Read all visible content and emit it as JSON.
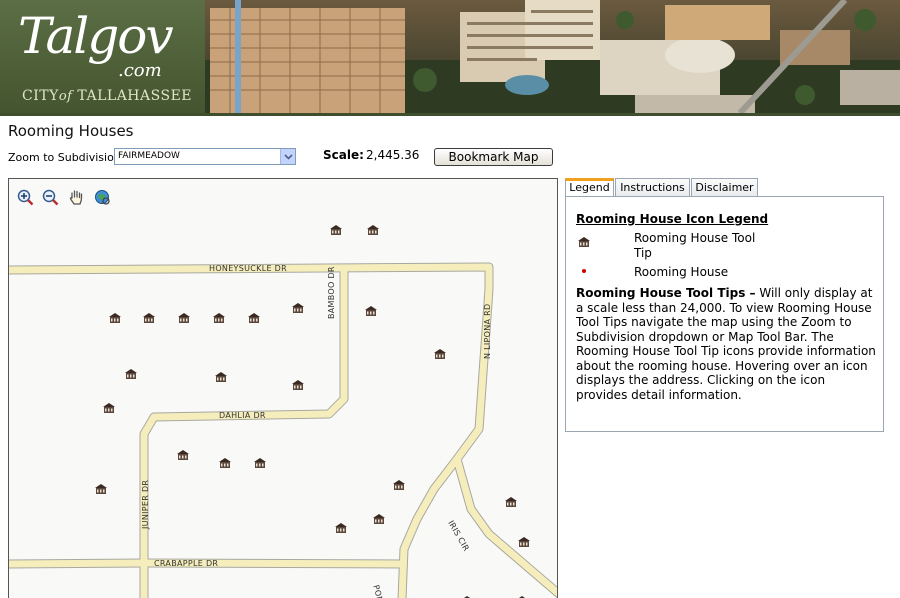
{
  "banner": {
    "logo_main": "Talgov",
    "logo_sub": ".com",
    "logo_city_a": "CITY",
    "logo_city_of": "of",
    "logo_city_b": "TALLAHASSEE"
  },
  "page": {
    "title": "Rooming Houses"
  },
  "controls": {
    "zoom_label": "Zoom to Subdivision",
    "subdivision_selected": "FAIRMEADOW",
    "scale_label": "Scale:",
    "scale_value": "2,445.36",
    "bookmark_label": "Bookmark Map"
  },
  "map": {
    "tools": [
      "zoom-in-icon",
      "zoom-out-icon",
      "pan-hand-icon",
      "full-extent-globe-icon"
    ],
    "roads": [
      {
        "name": "honeysuckle",
        "label": "HONEYSUCKLE DR"
      },
      {
        "name": "bamboo",
        "label": "BAMBOO DR"
      },
      {
        "name": "n-lipona",
        "label": "N LIPONA RD"
      },
      {
        "name": "dahlia",
        "label": "DAHLIA DR"
      },
      {
        "name": "juniper",
        "label": "JUNIPER DR"
      },
      {
        "name": "crabapple",
        "label": "CRABAPPLE DR"
      },
      {
        "name": "iris",
        "label": "IRIS CIR"
      },
      {
        "name": "lipona-south",
        "label": "PONA RD"
      }
    ],
    "road_color": "#f5eebc",
    "house_icon": "rooming-house-icon"
  },
  "tabs": [
    {
      "label": "Legend",
      "active": true
    },
    {
      "label": "Instructions",
      "active": false
    },
    {
      "label": "Disclaimer",
      "active": false
    }
  ],
  "legend": {
    "title": "Rooming House Icon Legend",
    "tip_label": "Rooming House Tool Tip",
    "dot_label": "Rooming House",
    "desc_bold": "Rooming House Tool Tips –",
    "desc_text": " Will only display at a scale less than 24,000.  To view Rooming House Tool Tips navigate the map using the Zoom to Subdivision dropdown or Map Tool Bar. The Rooming House Tool Tip icons provide information about the rooming house. Hovering over an icon displays the address. Clicking on the icon provides detail information.",
    "dot_color": "#cc0000"
  }
}
